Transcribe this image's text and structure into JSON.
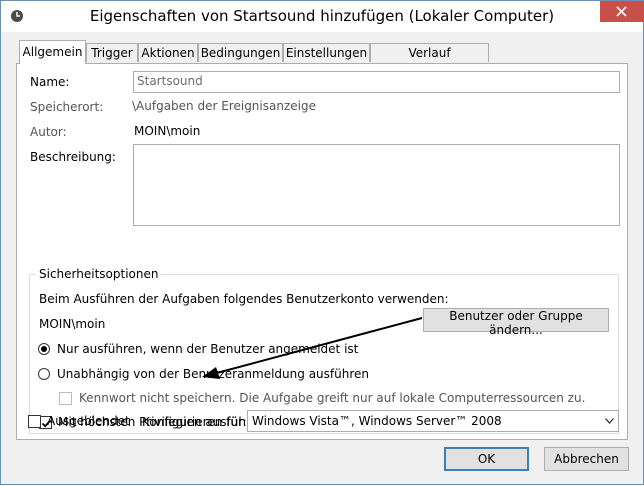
{
  "window": {
    "title": "Eigenschaften von Startsound hinzufügen (Lokaler Computer)"
  },
  "tabs": [
    {
      "label": "Allgemein"
    },
    {
      "label": "Trigger"
    },
    {
      "label": "Aktionen"
    },
    {
      "label": "Bedingungen"
    },
    {
      "label": "Einstellungen"
    },
    {
      "label": "Verlauf (deaktiviert)"
    }
  ],
  "general": {
    "name_label": "Name:",
    "name_value": "Startsound",
    "location_label": "Speicherort:",
    "location_value": "\\Aufgaben der Ereignisanzeige",
    "author_label": "Autor:",
    "author_value": "MOIN\\moin",
    "description_label": "Beschreibung:",
    "description_value": ""
  },
  "security": {
    "title": "Sicherheitsoptionen",
    "account_prompt": "Beim Ausführen der Aufgaben folgendes Benutzerkonto verwenden:",
    "account_value": "MOIN\\moin",
    "change_button": "Benutzer oder Gruppe ändern...",
    "radio_logged_on": "Nur ausführen, wenn der Benutzer angemeldet ist",
    "radio_independent": "Unabhängig von der Benutzeranmeldung ausführen",
    "no_store_password": "Kennwort nicht speichern. Die Aufgabe greift nur auf lokale Computerressourcen zu.",
    "highest_privileges": "Mit höchsten Privilegien ausführen"
  },
  "bottom": {
    "hidden_label": "Ausgeblendet",
    "configure_label": "Konfigurieren für:",
    "configure_value": "Windows Vista™, Windows Server™ 2008"
  },
  "buttons": {
    "ok": "OK",
    "cancel": "Abbrechen"
  },
  "state": {
    "selected_radio": "logged_on",
    "highest_privileges_checked": true,
    "hidden_checked": false,
    "no_store_password_checked": false,
    "no_store_password_enabled": false
  },
  "colors": {
    "close_button": "#c7504b",
    "default_button_border": "#3c7fb1"
  }
}
